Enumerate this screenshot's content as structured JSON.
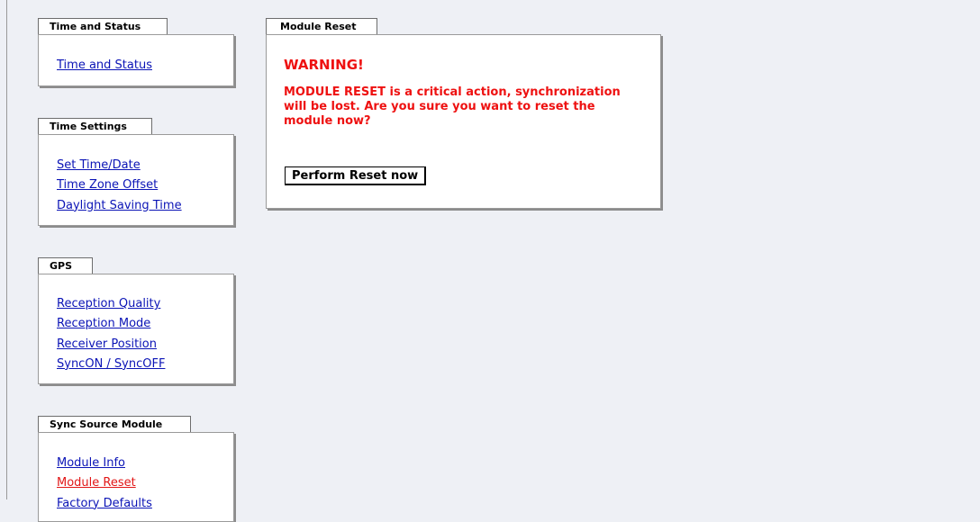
{
  "sidebar": {
    "time_status": {
      "tab": "Time and Status",
      "links": [
        "Time and Status"
      ]
    },
    "time_settings": {
      "tab": "Time Settings",
      "links": [
        "Set Time/Date",
        "Time Zone Offset",
        "Daylight Saving Time"
      ]
    },
    "gps": {
      "tab": "GPS",
      "links": [
        "Reception Quality",
        "Reception Mode",
        "Receiver Position",
        "SyncON / SyncOFF"
      ]
    },
    "sync_source": {
      "tab": "Sync Source Module",
      "links": [
        "Module Info",
        "Module Reset",
        "Factory Defaults"
      ]
    }
  },
  "main": {
    "tab": "Module Reset",
    "warning_title": "WARNING!",
    "warning_text": "MODULE RESET is a critical action, synchronization will be lost. Are you sure you want to reset the module now?",
    "button_label": "Perform Reset now"
  },
  "colors": {
    "background": "#eef0f5",
    "link": "#0b14b6",
    "active_link": "#e21717",
    "warning": "#ee1111"
  }
}
